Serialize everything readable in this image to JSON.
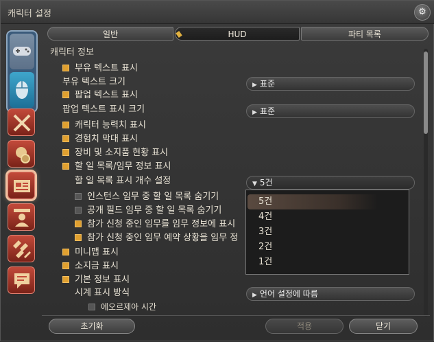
{
  "window": {
    "title": "캐릭터 설정",
    "close_label": "⚙"
  },
  "tabs": [
    {
      "label": "일반"
    },
    {
      "label": "HUD"
    },
    {
      "label": "파티 목록"
    }
  ],
  "section": {
    "header": "캐릭터 정보"
  },
  "rows": {
    "r1": "부유 텍스트 표시",
    "r2": "부유 텍스트 크기",
    "r3": "팝업 텍스트 표시",
    "r4": "팝업 텍스트 표시 크기",
    "r5": "캐릭터 능력치 표시",
    "r6": "경험치 막대 표시",
    "r7": "장비 및 소지품 현황 표시",
    "r8": "할 일 목록/임무 정보 표시",
    "r9": "할 일 목록 표시 개수 설정",
    "r10": "인스턴스 임무 중 할 일 목록 숨기기",
    "r11": "공개 필드 임무 중 할 일 목록 숨기기",
    "r12": "참가 신청 중인 임무를 임무 정보에 표시",
    "r13": "참가 신청 중인 임무 예약 상황을 임무 정",
    "r14": "미니맵 표시",
    "r15": "소지금 표시",
    "r16": "기본 정보 표시",
    "r17": "시계 표시 방식",
    "r18": "에오르제아 시간"
  },
  "dropdowns": {
    "float_size": "표준",
    "popup_size": "표준",
    "todo_count": "5건",
    "clock_mode": "언어 설정에 따름"
  },
  "popup_options": [
    "5건",
    "4건",
    "3건",
    "2건",
    "1건"
  ],
  "footer": {
    "reset": "초기화",
    "apply": "적용",
    "close": "닫기"
  },
  "colors": {
    "checkbox_on": "#e0a030",
    "accent_category": "#c24a3a",
    "device_active": "#2f8fb8"
  }
}
